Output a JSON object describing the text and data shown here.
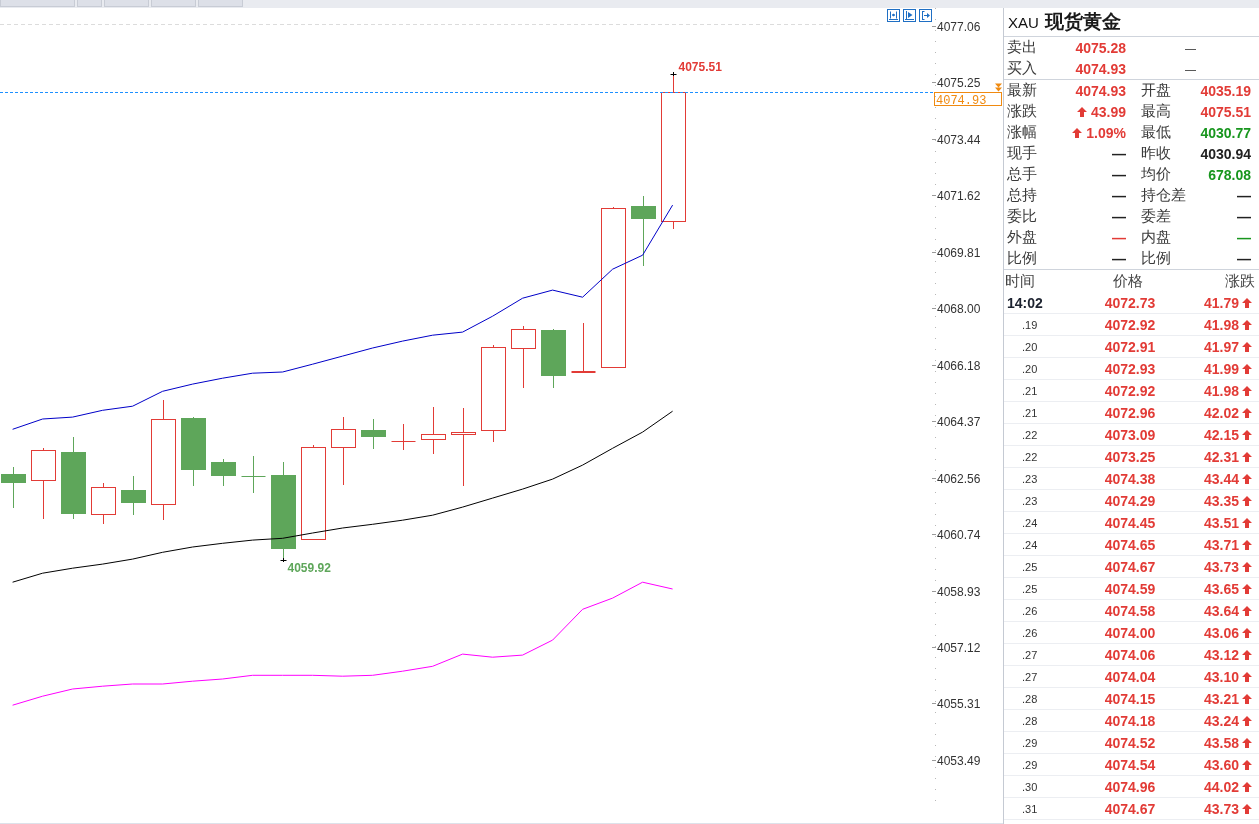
{
  "chart": {
    "chart_data": [
      {
        "type": "candlestick",
        "categories": [
          null,
          null,
          null,
          null,
          null,
          null,
          null,
          null,
          null,
          null,
          null,
          null,
          null,
          null,
          null,
          null,
          null,
          null,
          null,
          null,
          null,
          null,
          null
        ],
        "ohlc": [
          [
            4062.67,
            4062.89,
            4061.58,
            4062.41
          ],
          [
            4062.48,
            4063.5,
            4061.22,
            4063.44
          ],
          [
            4063.38,
            4063.86,
            4061.22,
            4061.42
          ],
          [
            4061.38,
            4062.38,
            4061.06,
            4062.25
          ],
          [
            4062.16,
            4062.61,
            4061.35,
            4061.77
          ],
          [
            4061.71,
            4065.05,
            4061.19,
            4064.44
          ],
          [
            4064.47,
            4064.5,
            4062.28,
            4062.83
          ],
          [
            4063.06,
            4063.15,
            4062.28,
            4062.64
          ],
          [
            4062.62,
            4063.25,
            4062.06,
            4062.61
          ],
          [
            4062.64,
            4063.06,
            4059.92,
            4060.29
          ],
          [
            4060.58,
            4063.6,
            4060.58,
            4063.54
          ],
          [
            4063.54,
            4064.5,
            4062.32,
            4064.11
          ],
          [
            4064.08,
            4064.44,
            4063.47,
            4063.89
          ],
          [
            4063.72,
            4064.28,
            4063.44,
            4063.73
          ],
          [
            4063.79,
            4064.82,
            4063.31,
            4063.95
          ],
          [
            4063.96,
            4064.79,
            4062.28,
            4064.01
          ],
          [
            4064.08,
            4066.81,
            4063.7,
            4066.75
          ],
          [
            4066.72,
            4067.42,
            4065.43,
            4067.33
          ],
          [
            4067.29,
            4067.33,
            4065.43,
            4065.85
          ],
          [
            4065.95,
            4067.52,
            4065.94,
            4065.98
          ],
          [
            4066.11,
            4071.24,
            4066.07,
            4071.21
          ],
          [
            4071.28,
            4071.6,
            4069.35,
            4070.89
          ],
          [
            4070.79,
            4075.51,
            4070.54,
            4074.93
          ]
        ],
        "colors": [
          "#5ea65a",
          "#e23b36",
          "#5ea65a",
          "#e23b36",
          "#5ea65a",
          "#e23b36",
          "#5ea65a",
          "#5ea65a",
          "#5ea65a",
          "#5ea65a",
          "#e23b36",
          "#e23b36",
          "#5ea65a",
          "#e23b36",
          "#e23b36",
          "#e23b36",
          "#e23b36",
          "#e23b36",
          "#5ea65a",
          "#e23b36",
          "#e23b36",
          "#5ea65a",
          "#e23b36"
        ],
        "series": [
          {
            "type": "line",
            "color": "#0000c8",
            "values": [
              4064.11,
              4064.44,
              4064.5,
              4064.72,
              4064.85,
              4065.33,
              4065.56,
              4065.75,
              4065.91,
              4065.95,
              4066.2,
              4066.46,
              4066.72,
              4066.94,
              4067.13,
              4067.23,
              4067.74,
              4068.32,
              4068.58,
              4068.35,
              4069.25,
              4069.7,
              4071.31
            ]
          },
          {
            "type": "line",
            "color": "#000000",
            "values": [
              4059.2,
              4059.49,
              4059.65,
              4059.78,
              4059.94,
              4060.16,
              4060.33,
              4060.45,
              4060.55,
              4060.61,
              4060.78,
              4060.94,
              4061.06,
              4061.19,
              4061.35,
              4061.61,
              4061.9,
              4062.19,
              4062.51,
              4062.96,
              4063.5,
              4064.02,
              4064.69
            ]
          },
          {
            "type": "line",
            "color": "#ff00ff",
            "values": [
              4055.25,
              4055.54,
              4055.77,
              4055.86,
              4055.93,
              4055.93,
              4056.02,
              4056.09,
              4056.21,
              4056.21,
              4056.21,
              4056.18,
              4056.21,
              4056.34,
              4056.5,
              4056.89,
              4056.79,
              4056.86,
              4057.34,
              4058.33,
              4058.69,
              4059.2,
              4058.98
            ]
          }
        ],
        "tick_labels": "y",
        "ylim": [
          4053.49,
          4077.06
        ],
        "yticks": [
          {
            "value": 4077.06,
            "label": "4077.06"
          },
          {
            "value": 4075.25,
            "label": "4075.25"
          },
          {
            "value": 4073.44,
            "label": "4073.44"
          },
          {
            "value": 4071.62,
            "label": "4071.62"
          },
          {
            "value": 4069.81,
            "label": "4069.81"
          },
          {
            "value": 4068.0,
            "label": "4068.00"
          },
          {
            "value": 4066.18,
            "label": "4066.18"
          },
          {
            "value": 4064.37,
            "label": "4064.37"
          },
          {
            "value": 4062.56,
            "label": "4062.56"
          },
          {
            "value": 4060.74,
            "label": "4060.74"
          },
          {
            "value": 4058.93,
            "label": "4058.93"
          },
          {
            "value": 4057.12,
            "label": "4057.12"
          },
          {
            "value": 4055.31,
            "label": "4055.31"
          },
          {
            "value": 4053.49,
            "label": "4053.49"
          }
        ],
        "ref_lines": [
          {
            "axis": "y",
            "value": 4074.93,
            "label": "4074.93",
            "color": "#1e90ff",
            "line_style": "dashed"
          }
        ],
        "annotations": [
          "4075.51",
          "4059.92"
        ]
      }
    ]
  },
  "quote": {
    "symbol": "XAU",
    "name": "现货黄金",
    "bid_ask": [
      {
        "label": "卖出",
        "value": "4075.28",
        "color": "#e23b36",
        "column_3": "—"
      },
      {
        "label": "买入",
        "value": "4074.93",
        "color": "#e23b36",
        "column_3": "—"
      }
    ],
    "stats": [
      [
        {
          "label": "最新",
          "value": "4074.93",
          "color": "#e23b36",
          "arrow": false
        },
        {
          "label": "开盘",
          "value": "4035.19",
          "color": "#e23b36",
          "arrow": false
        }
      ],
      [
        {
          "label": "涨跌",
          "value": "43.99",
          "color": "#e23b36",
          "arrow": true
        },
        {
          "label": "最高",
          "value": "4075.51",
          "color": "#e23b36",
          "arrow": false
        }
      ],
      [
        {
          "label": "涨幅",
          "value": "1.09%",
          "color": "#e23b36",
          "arrow": true
        },
        {
          "label": "最低",
          "value": "4030.77",
          "color": "#18961e",
          "arrow": false
        }
      ],
      [
        {
          "label": "现手",
          "value": "—",
          "color": "#222222",
          "arrow": false
        },
        {
          "label": "昨收",
          "value": "4030.94",
          "color": "#222222",
          "arrow": false
        }
      ],
      [
        {
          "label": "总手",
          "value": "—",
          "color": "#222222",
          "arrow": false
        },
        {
          "label": "均价",
          "value": "678.08",
          "color": "#18961e",
          "arrow": false
        }
      ],
      [
        {
          "label": "总持",
          "value": "—",
          "color": "#222222",
          "arrow": false
        },
        {
          "label": "持仓差",
          "value": "—",
          "color": "#222222",
          "arrow": false
        }
      ],
      [
        {
          "label": "委比",
          "value": "—",
          "color": "#222222",
          "arrow": false
        },
        {
          "label": "委差",
          "value": "—",
          "color": "#222222",
          "arrow": false
        }
      ],
      [
        {
          "label": "外盘",
          "value": "—",
          "color": "#e23b36",
          "arrow": false
        },
        {
          "label": "内盘",
          "value": "—",
          "color": "#18961e",
          "arrow": false
        }
      ],
      [
        {
          "label": "比例",
          "value": "—",
          "color": "#222222",
          "arrow": false
        },
        {
          "label": "比例",
          "value": "—",
          "color": "#222222",
          "arrow": false
        }
      ]
    ]
  },
  "ticks": {
    "columns": [
      "时间",
      "价格",
      "涨跌"
    ],
    "rows": [
      {
        "time": "14:02",
        "kind": "minute",
        "price": "4072.73",
        "change": "41.79",
        "color": "#e23b36",
        "up": true
      },
      {
        "time": ".19",
        "kind": "second",
        "price": "4072.92",
        "change": "41.98",
        "color": "#e23b36",
        "up": true
      },
      {
        "time": ".20",
        "kind": "second",
        "price": "4072.91",
        "change": "41.97",
        "color": "#e23b36",
        "up": true
      },
      {
        "time": ".20",
        "kind": "second",
        "price": "4072.93",
        "change": "41.99",
        "color": "#e23b36",
        "up": true
      },
      {
        "time": ".21",
        "kind": "second",
        "price": "4072.92",
        "change": "41.98",
        "color": "#e23b36",
        "up": true
      },
      {
        "time": ".21",
        "kind": "second",
        "price": "4072.96",
        "change": "42.02",
        "color": "#e23b36",
        "up": true
      },
      {
        "time": ".22",
        "kind": "second",
        "price": "4073.09",
        "change": "42.15",
        "color": "#e23b36",
        "up": true
      },
      {
        "time": ".22",
        "kind": "second",
        "price": "4073.25",
        "change": "42.31",
        "color": "#e23b36",
        "up": true
      },
      {
        "time": ".23",
        "kind": "second",
        "price": "4074.38",
        "change": "43.44",
        "color": "#e23b36",
        "up": true
      },
      {
        "time": ".23",
        "kind": "second",
        "price": "4074.29",
        "change": "43.35",
        "color": "#e23b36",
        "up": true
      },
      {
        "time": ".24",
        "kind": "second",
        "price": "4074.45",
        "change": "43.51",
        "color": "#e23b36",
        "up": true
      },
      {
        "time": ".24",
        "kind": "second",
        "price": "4074.65",
        "change": "43.71",
        "color": "#e23b36",
        "up": true
      },
      {
        "time": ".25",
        "kind": "second",
        "price": "4074.67",
        "change": "43.73",
        "color": "#e23b36",
        "up": true
      },
      {
        "time": ".25",
        "kind": "second",
        "price": "4074.59",
        "change": "43.65",
        "color": "#e23b36",
        "up": true
      },
      {
        "time": ".26",
        "kind": "second",
        "price": "4074.58",
        "change": "43.64",
        "color": "#e23b36",
        "up": true
      },
      {
        "time": ".26",
        "kind": "second",
        "price": "4074.00",
        "change": "43.06",
        "color": "#e23b36",
        "up": true
      },
      {
        "time": ".27",
        "kind": "second",
        "price": "4074.06",
        "change": "43.12",
        "color": "#e23b36",
        "up": true
      },
      {
        "time": ".27",
        "kind": "second",
        "price": "4074.04",
        "change": "43.10",
        "color": "#e23b36",
        "up": true
      },
      {
        "time": ".28",
        "kind": "second",
        "price": "4074.15",
        "change": "43.21",
        "color": "#e23b36",
        "up": true
      },
      {
        "time": ".28",
        "kind": "second",
        "price": "4074.18",
        "change": "43.24",
        "color": "#e23b36",
        "up": true
      },
      {
        "time": ".29",
        "kind": "second",
        "price": "4074.52",
        "change": "43.58",
        "color": "#e23b36",
        "up": true
      },
      {
        "time": ".29",
        "kind": "second",
        "price": "4074.54",
        "change": "43.60",
        "color": "#e23b36",
        "up": true
      },
      {
        "time": ".30",
        "kind": "second",
        "price": "4074.96",
        "change": "44.02",
        "color": "#e23b36",
        "up": true
      },
      {
        "time": ".31",
        "kind": "second",
        "price": "4074.67",
        "change": "43.73",
        "color": "#e23b36",
        "up": true
      }
    ]
  }
}
